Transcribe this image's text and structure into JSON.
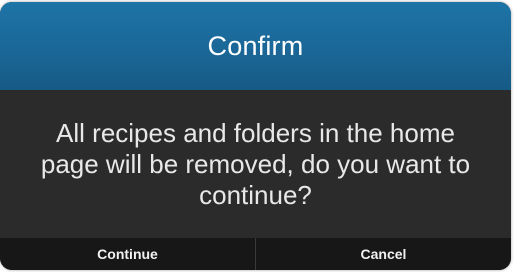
{
  "dialog": {
    "title": "Confirm",
    "message": "All recipes and folders in the home page will be removed, do you want to continue?",
    "buttons": {
      "continue_label": "Continue",
      "cancel_label": "Cancel"
    }
  },
  "colors": {
    "header": "#1a6797",
    "body": "#2b2b2b",
    "footer": "#171717"
  }
}
